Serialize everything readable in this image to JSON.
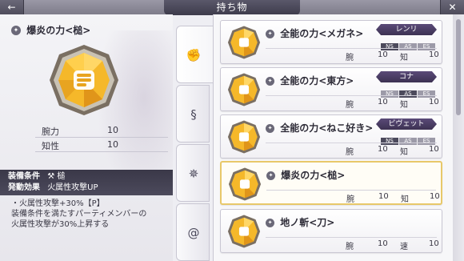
{
  "header": {
    "title": "持ち物",
    "back_glyph": "←",
    "close_glyph": "✕"
  },
  "detail": {
    "name": "爆炎の力<槌>",
    "type_icon": "mastery-emblem-icon",
    "stats": [
      {
        "label": "腕力",
        "value": "10"
      },
      {
        "label": "知性",
        "value": "10"
      }
    ],
    "equip_condition_label": "装備条件",
    "equip_condition_value": "槌",
    "trigger_label": "発動効果",
    "trigger_value": "火属性攻撃UP",
    "effect_lines": [
      "・火属性攻撃+30%【P】",
      "装備条件を満たすパーティメンバーの",
      "火属性攻撃が30%上昇する"
    ]
  },
  "tabs": [
    {
      "icon": "fist-icon",
      "glyph": "✊"
    },
    {
      "icon": "swirl-icon",
      "glyph": "§"
    },
    {
      "icon": "star-compass-icon",
      "glyph": "✵"
    },
    {
      "icon": "spiral-icon",
      "glyph": "@"
    }
  ],
  "items": [
    {
      "name": "全能の力<メガネ>",
      "character": "レンリ",
      "flags": [
        "NS",
        "AS",
        "ES"
      ],
      "flags_on": [
        true,
        false,
        false
      ],
      "stat1_label": "腕",
      "stat1_value": "10",
      "stat2_label": "知",
      "stat2_value": "10"
    },
    {
      "name": "全能の力<東方>",
      "character": "コナ",
      "flags": [
        "NS",
        "AS",
        "ES"
      ],
      "flags_on": [
        false,
        true,
        false
      ],
      "stat1_label": "腕",
      "stat1_value": "10",
      "stat2_label": "知",
      "stat2_value": "10"
    },
    {
      "name": "全能の力<ねこ好き>",
      "character": "ビヴェット",
      "flags": [
        "NS",
        "AS",
        "ES"
      ],
      "flags_on": [
        true,
        false,
        false
      ],
      "stat1_label": "腕",
      "stat1_value": "10",
      "stat2_label": "知",
      "stat2_value": "10"
    },
    {
      "name": "爆炎の力<槌>",
      "character": "",
      "flags": [],
      "flags_on": [],
      "stat1_label": "腕",
      "stat1_value": "10",
      "stat2_label": "知",
      "stat2_value": "10"
    },
    {
      "name": "地ノ斬<刀>",
      "character": "",
      "flags": [],
      "flags_on": [],
      "stat1_label": "腕",
      "stat1_value": "10",
      "stat2_label": "速",
      "stat2_value": "10"
    }
  ],
  "selected_index": 3,
  "colors": {
    "gem_gold": "#f5b82a",
    "gem_frame": "#7a6f62",
    "accent_dark": "#3a3848",
    "selected_border": "#e8c86a"
  }
}
